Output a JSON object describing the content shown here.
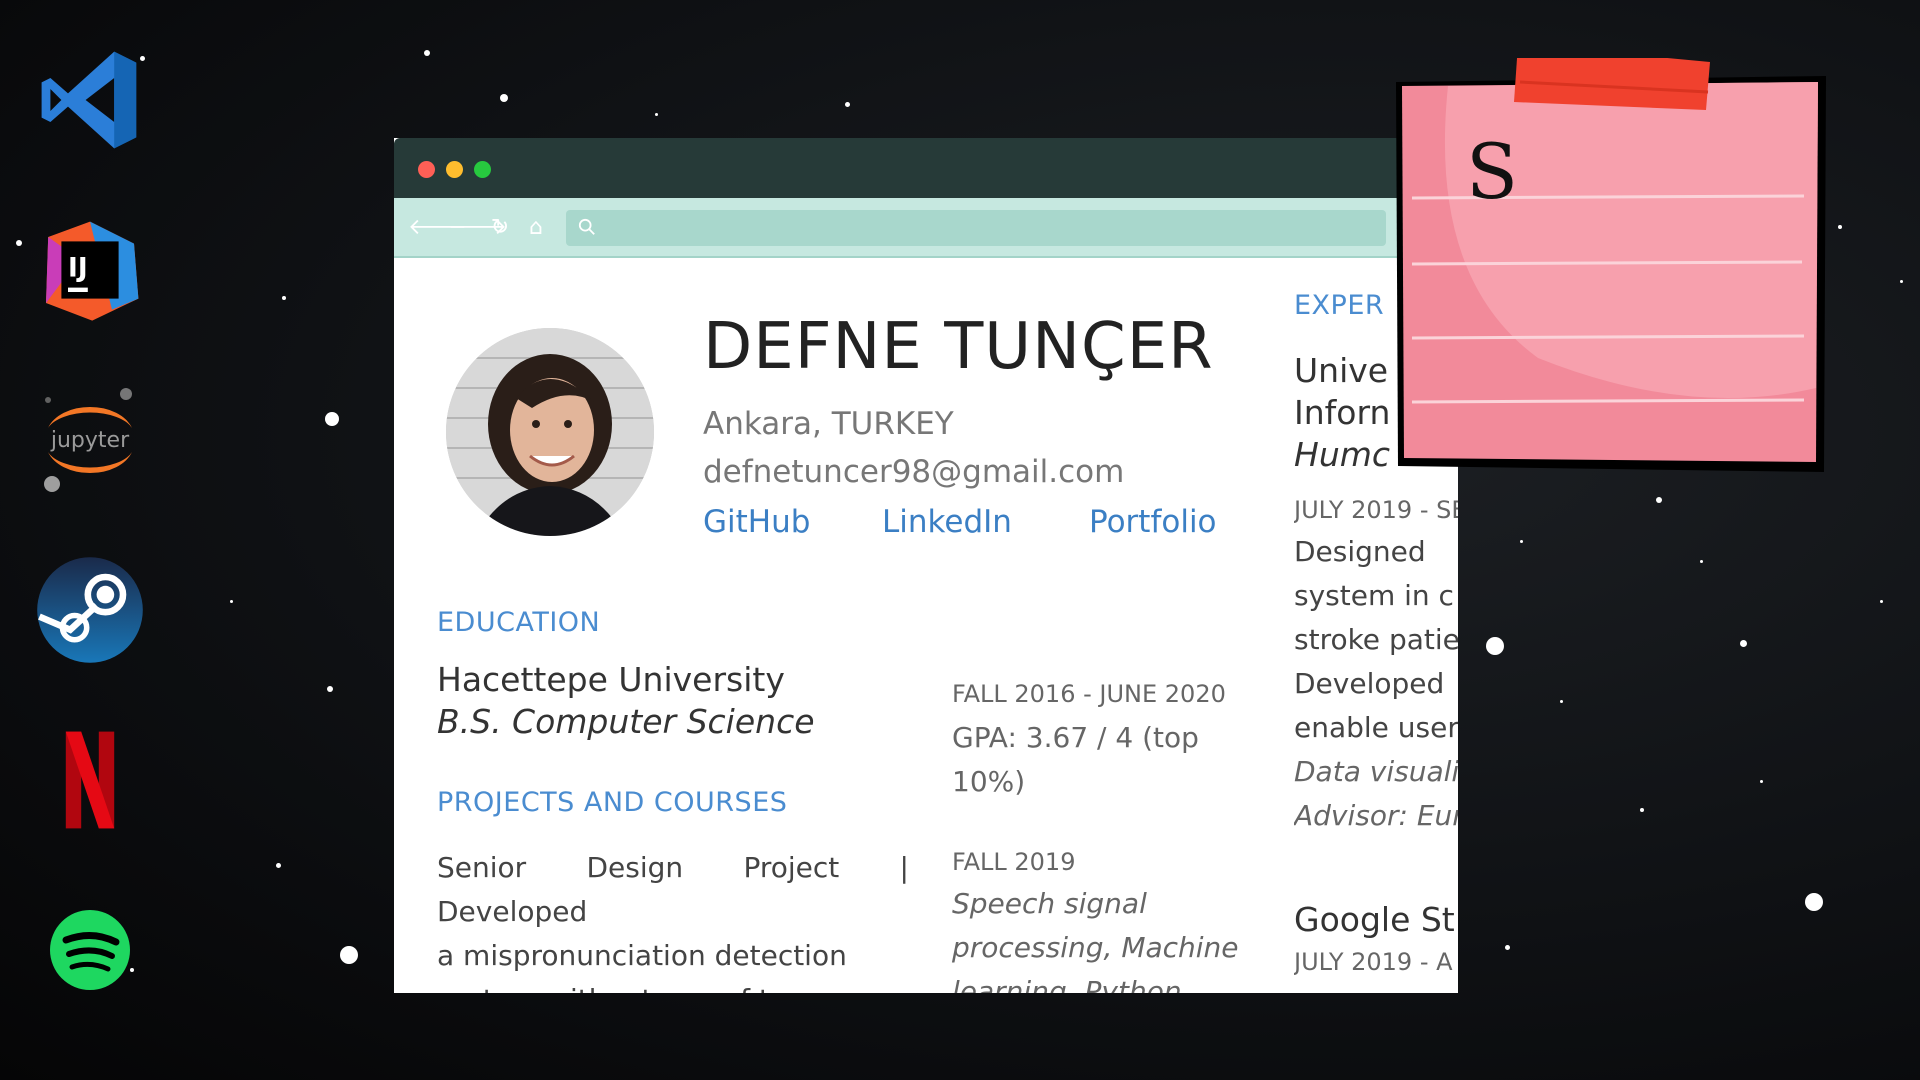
{
  "dock": {
    "apps": [
      {
        "name": "Visual Studio Code",
        "icon": "vscode-icon"
      },
      {
        "name": "IntelliJ IDEA",
        "icon": "intellij-icon",
        "label": "IJ"
      },
      {
        "name": "Jupyter",
        "icon": "jupyter-icon",
        "label": "jupyter"
      },
      {
        "name": "Steam",
        "icon": "steam-icon"
      },
      {
        "name": "Netflix",
        "icon": "netflix-icon",
        "label": "N"
      },
      {
        "name": "Spotify",
        "icon": "spotify-icon"
      }
    ]
  },
  "browser": {
    "url": "",
    "colors": {
      "titlebar": "#263a38",
      "toolbar": "#c6e8e0",
      "accent": "#3b7fc4"
    }
  },
  "profile": {
    "name": "DEFNE TUNÇER",
    "location": "Ankara, TURKEY",
    "email": "defnetuncer98@gmail.com",
    "links": [
      "GitHub",
      "LinkedIn",
      "Portfolio"
    ]
  },
  "education": {
    "heading": "EDUCATION",
    "school": "Hacettepe University",
    "degree": "B.S. Computer Science",
    "dates": "FALL 2016 - JUNE 2020",
    "gpa_line1": "GPA:  3.67  /  4  (top",
    "gpa_line2": "10%)"
  },
  "projects": {
    "heading": "PROJECTS AND COURSES",
    "line1": "Senior Design Project | Developed",
    "line2": "a   mispronunciation   detection",
    "line3": "system  with  a  team  of  two.",
    "date": "FALL 2019",
    "tags1": "Speech signal",
    "tags2": "processing, Machine",
    "tags3": "learning, Python"
  },
  "experience": {
    "heading": "EXPER",
    "org1": "Unive",
    "org2": "Inforn",
    "role": "Humc",
    "dates": "JULY 2019 - SE",
    "d1": "Designed",
    "d2": "system  in  c",
    "d3": "stroke patie",
    "d4": "Developed",
    "d5": "enable users",
    "d6": "Data visuali",
    "d7": "Advisor: Eur",
    "org3": "Google St",
    "dates2": "JULY 2019 - A"
  },
  "sticky_note": {
    "text": "S",
    "tape_color": "#f0412e",
    "note_color": "#f59aa8"
  }
}
